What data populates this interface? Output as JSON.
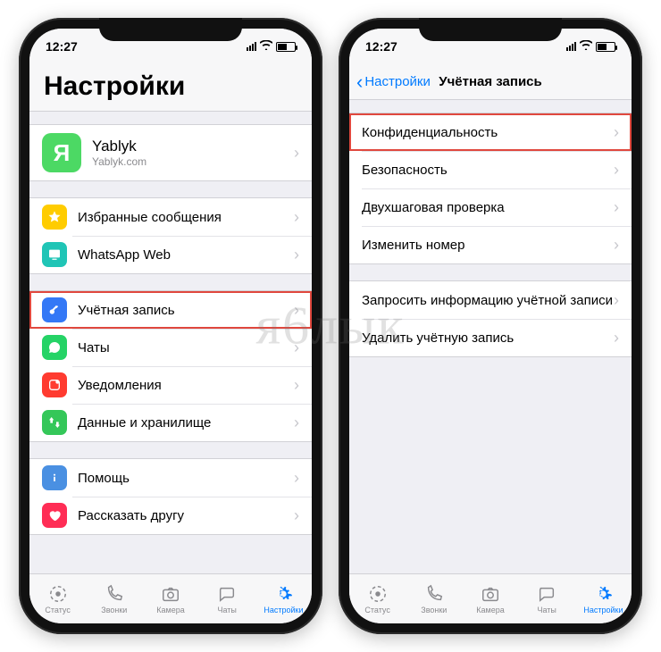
{
  "status": {
    "time": "12:27"
  },
  "watermark": "я6лык",
  "left": {
    "title": "Настройки",
    "profile": {
      "initial": "Я",
      "name": "Yablyk",
      "subtitle": "Yablyk.com"
    },
    "group1": [
      {
        "label": "Избранные сообщения"
      },
      {
        "label": "WhatsApp Web"
      }
    ],
    "group2": [
      {
        "label": "Учётная запись"
      },
      {
        "label": "Чаты"
      },
      {
        "label": "Уведомления"
      },
      {
        "label": "Данные и хранилище"
      }
    ],
    "group3": [
      {
        "label": "Помощь"
      },
      {
        "label": "Рассказать другу"
      }
    ]
  },
  "right": {
    "back": "Настройки",
    "title": "Учётная запись",
    "group1": [
      {
        "label": "Конфиденциальность"
      },
      {
        "label": "Безопасность"
      },
      {
        "label": "Двухшаговая проверка"
      },
      {
        "label": "Изменить номер"
      }
    ],
    "group2": [
      {
        "label": "Запросить информацию учётной записи"
      },
      {
        "label": "Удалить учётную запись"
      }
    ]
  },
  "tabs": {
    "status": "Статус",
    "calls": "Звонки",
    "camera": "Камера",
    "chats": "Чаты",
    "settings": "Настройки"
  }
}
